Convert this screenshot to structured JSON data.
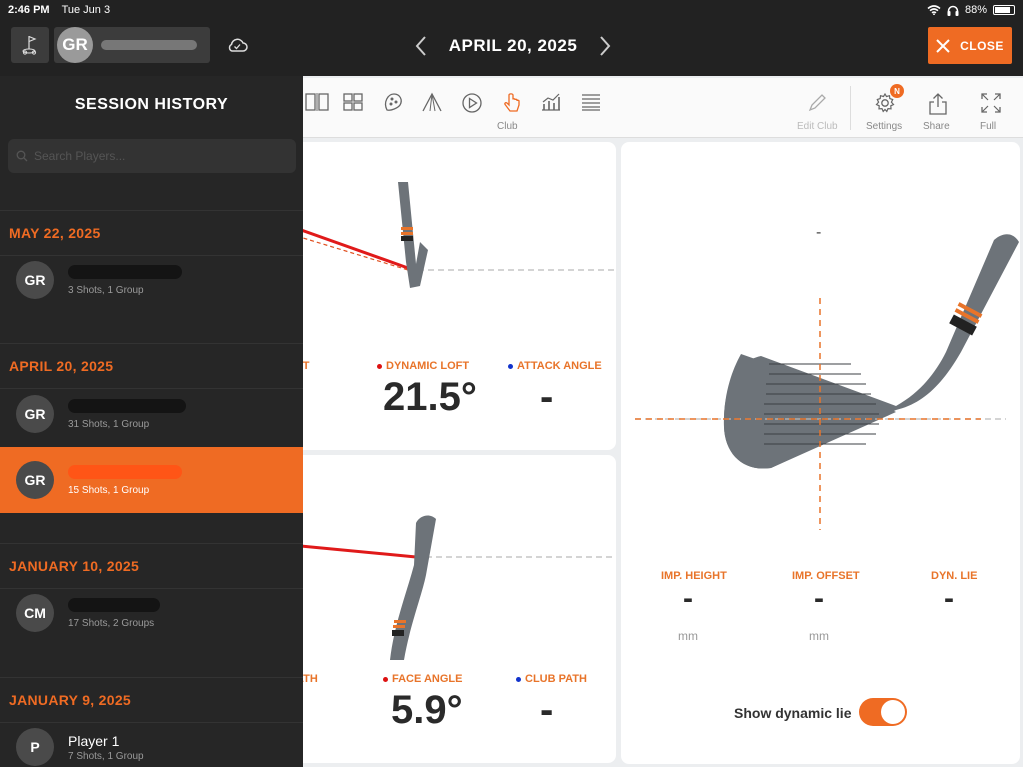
{
  "status_bar": {
    "time": "2:46 PM",
    "date": "Tue Jun 3",
    "battery": "88%"
  },
  "header": {
    "player_initials": "GR",
    "date_title": "APRIL 20, 2025",
    "close_label": "CLOSE"
  },
  "toolbar": {
    "club_label": "Club",
    "edit_club_label": "Edit Club",
    "settings_label": "Settings",
    "settings_badge": "N",
    "share_label": "Share",
    "full_label": "Full"
  },
  "loft_card": {
    "partial_label": "FT",
    "dynamic_loft_label": "DYNAMIC LOFT",
    "dynamic_loft_value": "21.5°",
    "attack_angle_label": "ATTACK ANGLE",
    "attack_angle_value": "-"
  },
  "face_card": {
    "partial_label": "ATH",
    "face_angle_label": "FACE ANGLE",
    "face_angle_value": "5.9°",
    "club_path_label": "CLUB PATH",
    "club_path_value": "-"
  },
  "impact_card": {
    "top_value": "-",
    "imp_height_label": "IMP. HEIGHT",
    "imp_height_value": "-",
    "imp_height_unit": "mm",
    "imp_offset_label": "IMP. OFFSET",
    "imp_offset_value": "-",
    "imp_offset_unit": "mm",
    "dyn_lie_label": "DYN. LIE",
    "dyn_lie_value": "-",
    "show_dynamic_lie_label": "Show dynamic lie",
    "show_dynamic_lie_on": true
  },
  "sidebar": {
    "title": "SESSION HISTORY",
    "search_placeholder": "Search Players...",
    "groups": [
      {
        "date": "MAY 22, 2025",
        "sessions": [
          {
            "initials": "GR",
            "meta": "3 Shots, 1 Group"
          }
        ]
      },
      {
        "date": "APRIL 20, 2025",
        "sessions": [
          {
            "initials": "GR",
            "meta": "31 Shots, 1 Group"
          },
          {
            "initials": "GR",
            "meta": "15 Shots, 1 Group",
            "selected": true
          }
        ]
      },
      {
        "date": "JANUARY 10, 2025",
        "sessions": [
          {
            "initials": "CM",
            "meta": "17 Shots, 2 Groups"
          }
        ]
      },
      {
        "date": "JANUARY 9, 2025",
        "sessions": [
          {
            "initials": "P",
            "name": "Player 1",
            "meta": "7 Shots, 1 Group"
          }
        ]
      }
    ]
  },
  "colors": {
    "accent": "#ef6b23",
    "dark": "#222222",
    "loft_dot": "#dd1111",
    "attack_dot": "#1133cc"
  }
}
